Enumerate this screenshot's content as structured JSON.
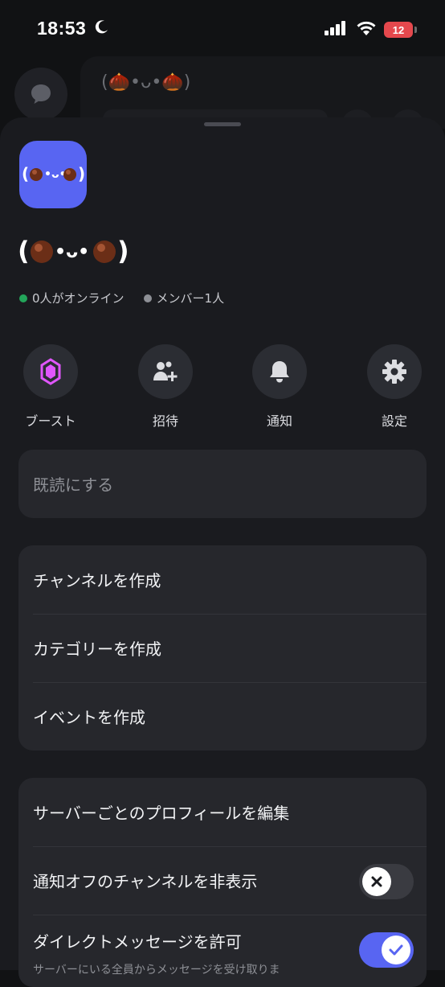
{
  "status_bar": {
    "time": "18:53",
    "battery": "12"
  },
  "background": {
    "server_title": "(🌰•ᴗ•🌰)"
  },
  "server": {
    "avatar_text": "(🌰•ᴗ•🌰)",
    "name": "(🌰•ᴗ•🌰)",
    "online": "0人がオンライン",
    "members": "メンバー1人"
  },
  "actions": [
    {
      "label": "ブースト",
      "icon": "boost-icon",
      "color": "#e056fd"
    },
    {
      "label": "招待",
      "icon": "invite-icon"
    },
    {
      "label": "通知",
      "icon": "bell-icon"
    },
    {
      "label": "設定",
      "icon": "gear-icon"
    }
  ],
  "mark_read": "既読にする",
  "create_menu": [
    "チャンネルを作成",
    "カテゴリーを作成",
    "イベントを作成"
  ],
  "settings_menu": {
    "edit_profile": "サーバーごとのプロフィールを編集",
    "hide_muted": "通知オフのチャンネルを非表示",
    "hide_muted_enabled": false,
    "allow_dm": "ダイレクトメッセージを許可",
    "allow_dm_sub": "サーバーにいる全員からメッセージを受け取りま",
    "allow_dm_enabled": true
  },
  "colors": {
    "accent": "#5865f2",
    "online": "#23a55a",
    "sheet": "#1a1b1f",
    "card": "#26272c"
  }
}
